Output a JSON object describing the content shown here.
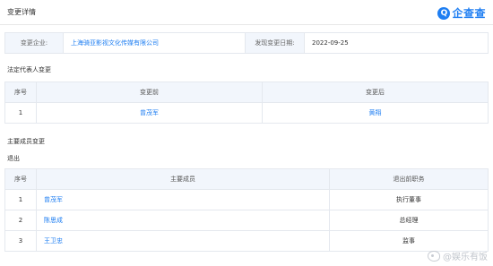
{
  "header": {
    "title": "变更详情",
    "logo_text": "企查查",
    "logo_mark": "Q"
  },
  "summary": {
    "company_label": "变更企业:",
    "company_name": "上海骑亚影视文化传媒有限公司",
    "date_label": "发现变更日期:",
    "date_value": "2022-09-25"
  },
  "legal_rep": {
    "section_title": "法定代表人变更",
    "headers": [
      "序号",
      "变更前",
      "变更后"
    ],
    "rows": [
      {
        "no": "1",
        "before": "曾茂军",
        "after": "黄翔"
      }
    ]
  },
  "members": {
    "section_title": "主要成员变更",
    "sub_title": "退出",
    "headers": [
      "序号",
      "主要成员",
      "退出前职务"
    ],
    "rows": [
      {
        "no": "1",
        "name": "曾茂军",
        "role": "执行董事"
      },
      {
        "no": "2",
        "name": "陈思成",
        "role": "总经理"
      },
      {
        "no": "3",
        "name": "王卫忠",
        "role": "监事"
      }
    ]
  },
  "watermark": {
    "text": "@娱乐有饭",
    "icon": "weibo-icon"
  }
}
